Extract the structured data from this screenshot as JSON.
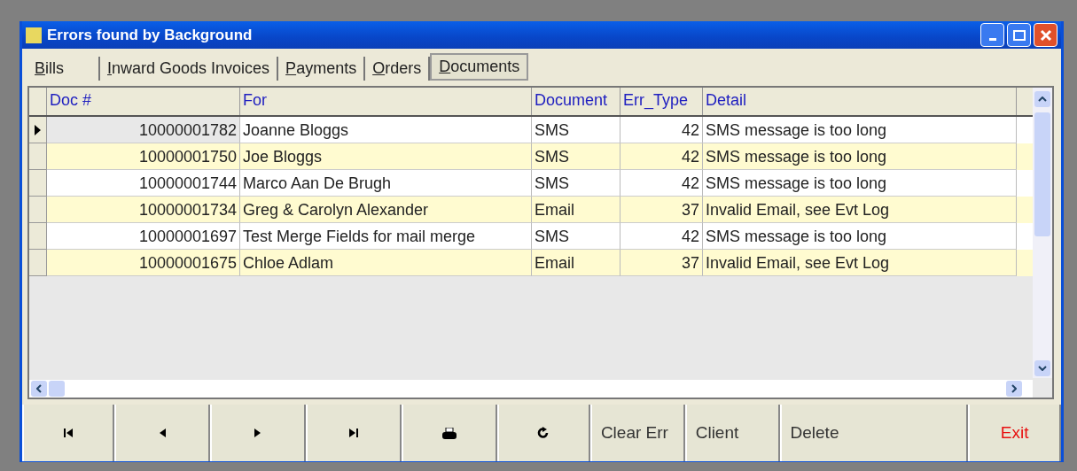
{
  "window": {
    "title": "Errors found by Background"
  },
  "tabs": [
    {
      "label": "Bills",
      "selected": false
    },
    {
      "label": "Inward Goods Invoices",
      "selected": false
    },
    {
      "label": "Payments",
      "selected": false
    },
    {
      "label": "Orders",
      "selected": false
    },
    {
      "label": "Documents",
      "selected": true
    }
  ],
  "table": {
    "columns": [
      "Doc #",
      "For",
      "Document",
      "Err_Type",
      "Detail"
    ],
    "rows": [
      {
        "selected": true,
        "cells": [
          "10000001782",
          "Joanne Bloggs",
          "SMS",
          "42",
          "SMS message is too long"
        ]
      },
      {
        "selected": false,
        "cells": [
          "10000001750",
          "Joe Bloggs",
          "SMS",
          "42",
          "SMS message is too long"
        ]
      },
      {
        "selected": false,
        "cells": [
          "10000001744",
          "Marco Aan De Brugh",
          "SMS",
          "42",
          "SMS message is too long"
        ]
      },
      {
        "selected": false,
        "cells": [
          "10000001734",
          "Greg & Carolyn Alexander",
          "Email",
          "37",
          "Invalid Email, see Evt Log"
        ]
      },
      {
        "selected": false,
        "cells": [
          "10000001697",
          "Test Merge Fields for mail merge",
          "SMS",
          "42",
          "SMS message is too long"
        ]
      },
      {
        "selected": false,
        "cells": [
          "10000001675",
          "Chloe Adlam",
          "Email",
          "37",
          "Invalid Email, see Evt Log"
        ]
      }
    ]
  },
  "buttons": [
    {
      "kind": "first"
    },
    {
      "kind": "previous"
    },
    {
      "kind": "next"
    },
    {
      "kind": "last"
    },
    {
      "kind": "print"
    },
    {
      "kind": "refresh"
    },
    {
      "kind": "text",
      "label": "Clear Err"
    },
    {
      "kind": "text",
      "label": "Client"
    },
    {
      "kind": "text",
      "label": "Delete"
    },
    {
      "kind": "exit",
      "label": "Exit"
    }
  ]
}
